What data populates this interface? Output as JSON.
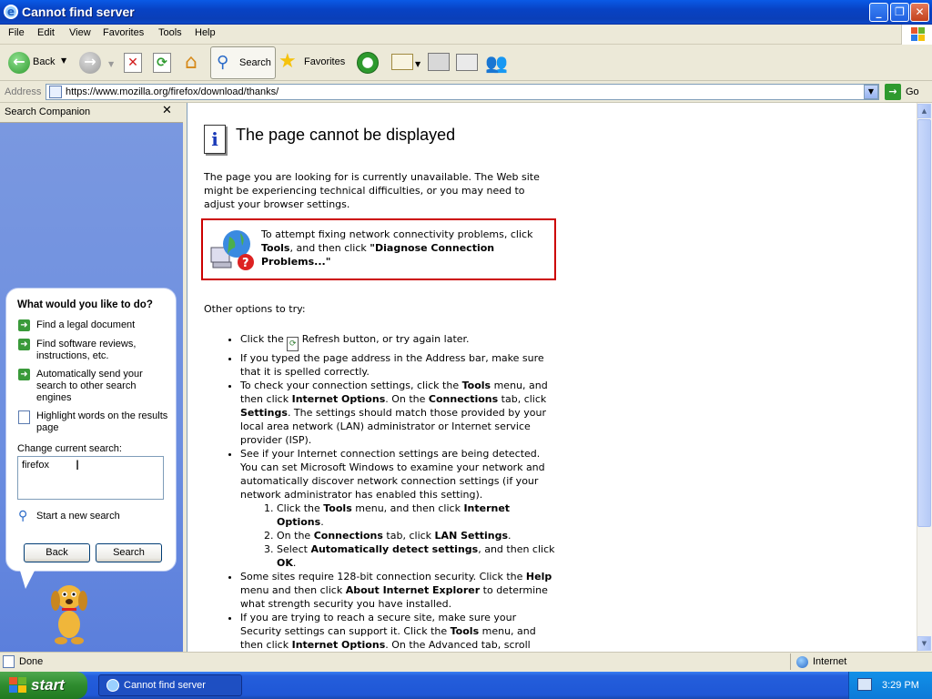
{
  "window": {
    "title": "Cannot find server"
  },
  "menu": [
    "File",
    "Edit",
    "View",
    "Favorites",
    "Tools",
    "Help"
  ],
  "toolbar": {
    "back_label": "Back",
    "search_label": "Search",
    "favorites_label": "Favorites",
    "go_label": "Go"
  },
  "address": {
    "label": "Address",
    "url": "https://www.mozilla.org/firefox/download/thanks/"
  },
  "sidebar": {
    "title": "Search Companion",
    "question": "What would you like to do?",
    "items": [
      "Find a legal document",
      "Find software reviews, instructions, etc.",
      "Automatically send your search to other search engines",
      "Highlight words on the results page"
    ],
    "change_search_label": "Change current search:",
    "search_value": "firefox",
    "new_search": "Start a new search",
    "back_button": "Back",
    "search_button": "Search"
  },
  "page": {
    "heading": "The page cannot be displayed",
    "intro": "The page you are looking for is currently unavailable. The Web site might be experiencing technical difficulties, or you may need to adjust your browser settings.",
    "diag_line1": "To attempt fixing network connectivity problems, click",
    "diag_tools": "Tools",
    "diag_mid": ", and then click ",
    "diag_action": "\"Diagnose Connection Problems...\"",
    "other_options": "Other options to try:",
    "b1_pre": "Click the ",
    "b1_post": " Refresh button, or try again later.",
    "b2": "If you typed the page address in the Address bar, make sure that it is spelled correctly.",
    "b3_a": "To check your connection settings, click the ",
    "b3_tools": "Tools",
    "b3_b": " menu, and then click ",
    "b3_io": "Internet Options",
    "b3_c": ". On the ",
    "b3_conn": "Connections",
    "b3_d": " tab, click ",
    "b3_settings": "Settings",
    "b3_e": ". The settings should match those provided by your local area network (LAN) administrator or Internet service provider (ISP).",
    "b4": "See if your Internet connection settings are being detected. You can set Microsoft Windows to examine your network and automatically discover network connection settings (if your network administrator has enabled this setting).",
    "n1_a": "Click the ",
    "n1_tools": "Tools",
    "n1_b": " menu, and then click ",
    "n1_io": "Internet Options",
    "n1_c": ".",
    "n2_a": "On the ",
    "n2_conn": "Connections",
    "n2_b": " tab, click ",
    "n2_lan": "LAN Settings",
    "n2_c": ".",
    "n3_a": "Select ",
    "n3_auto": "Automatically detect settings",
    "n3_b": ", and then click ",
    "n3_ok": "OK",
    "n3_c": ".",
    "b5_a": "Some sites require 128-bit connection security. Click the ",
    "b5_help": "Help",
    "b5_b": " menu and then click ",
    "b5_about": "About Internet Explorer",
    "b5_c": " to determine what strength security you have installed.",
    "b6_a": "If you are trying to reach a secure site, make sure your Security settings can support it. Click the ",
    "b6_tools": "Tools",
    "b6_b": " menu, and then click ",
    "b6_io": "Internet Options",
    "b6_c": ". On the Advanced tab, scroll"
  },
  "status": {
    "left": "Done",
    "zone": "Internet"
  },
  "taskbar": {
    "start": "start",
    "task": "Cannot find server",
    "time": "3:29 PM"
  }
}
